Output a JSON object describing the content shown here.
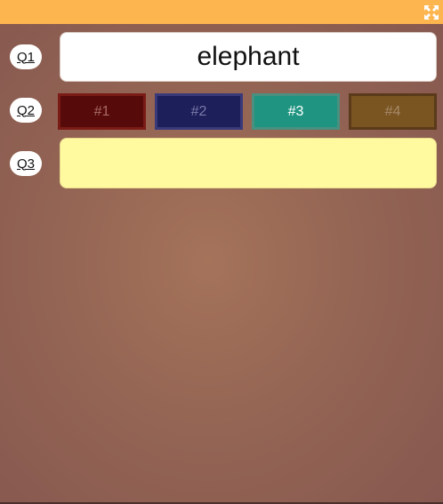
{
  "colors": {
    "topbar": "#fdb54f",
    "q3_fill": "#fff9a0"
  },
  "toolbar": {
    "fullscreen_icon": "expand-arrows-icon"
  },
  "questions": [
    {
      "label": "Q1",
      "answer": "elephant"
    },
    {
      "label": "Q2",
      "choices": [
        {
          "label": "#1",
          "fill": "#560a0a",
          "border": "#7a1b16",
          "text": "#a86a62",
          "selected": false
        },
        {
          "label": "#2",
          "fill": "#1c1f5a",
          "border": "#3a3a7a",
          "text": "#7a7aa8",
          "selected": false
        },
        {
          "label": "#3",
          "fill": "#1f9480",
          "border": "#4a8f80",
          "text": "#ffffff",
          "selected": true
        },
        {
          "label": "#4",
          "fill": "#7a5421",
          "border": "#5a3a1a",
          "text": "#a58a6a",
          "selected": false
        }
      ]
    },
    {
      "label": "Q3",
      "answer": ""
    }
  ]
}
